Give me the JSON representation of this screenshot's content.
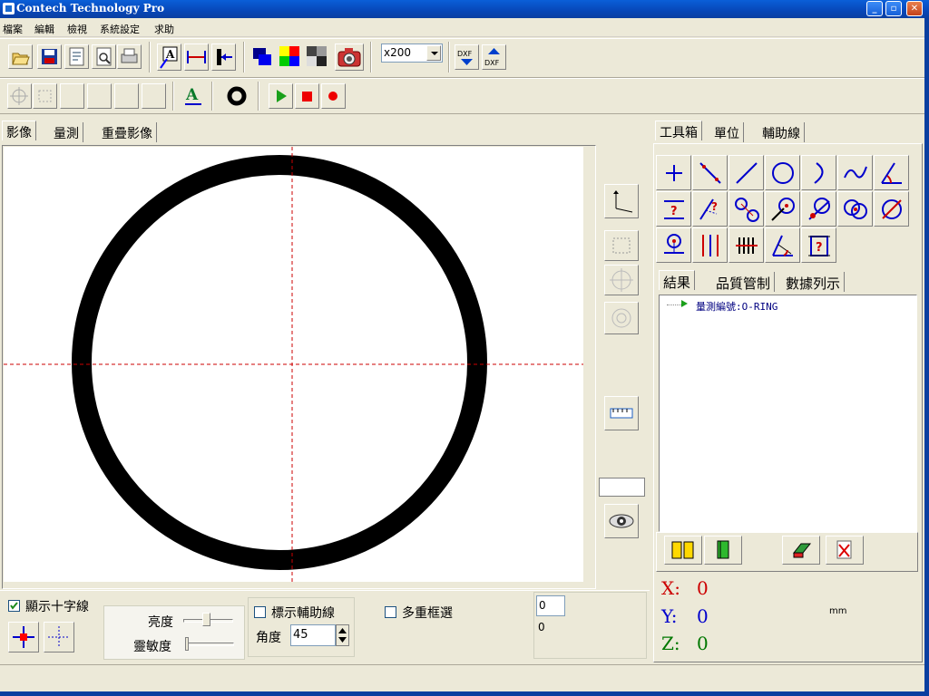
{
  "window": {
    "title": "Contech Technology Pro"
  },
  "menu": [
    "檔案",
    "編輯",
    "檢視",
    "系統設定",
    "求助"
  ],
  "toolbar": {
    "zoom_value": "x200",
    "dxf1": "DXF",
    "dxf2": "DXF"
  },
  "left_tabs": [
    "影像",
    "量測",
    "重疊影像"
  ],
  "right_tabs": [
    "工具箱",
    "單位",
    "輔助線"
  ],
  "result_tabs": [
    "結果",
    "品質管制",
    "數據列示"
  ],
  "tree": {
    "item": "量測編號:O-RING"
  },
  "bottom": {
    "show_crosshair_label": "顯示十字線",
    "brightness_label": "亮度",
    "sensitivity_label": "靈敏度",
    "mark_guides_label": "標示輔助線",
    "angle_label": "角度",
    "angle_value": "45",
    "multi_select_label": "多重框選",
    "count_value": "0",
    "count_text": "0"
  },
  "coords": {
    "x_label": "X:",
    "x_value": "0",
    "y_label": "Y:",
    "y_value": "0",
    "z_label": "Z:",
    "z_value": "0",
    "unit": "mm"
  },
  "colors": {
    "coord_label": "#cc0000",
    "coord_y": "#0000cc",
    "coord_z": "#007700",
    "crosshair": "#cc0000",
    "tree_text": "#000080"
  }
}
